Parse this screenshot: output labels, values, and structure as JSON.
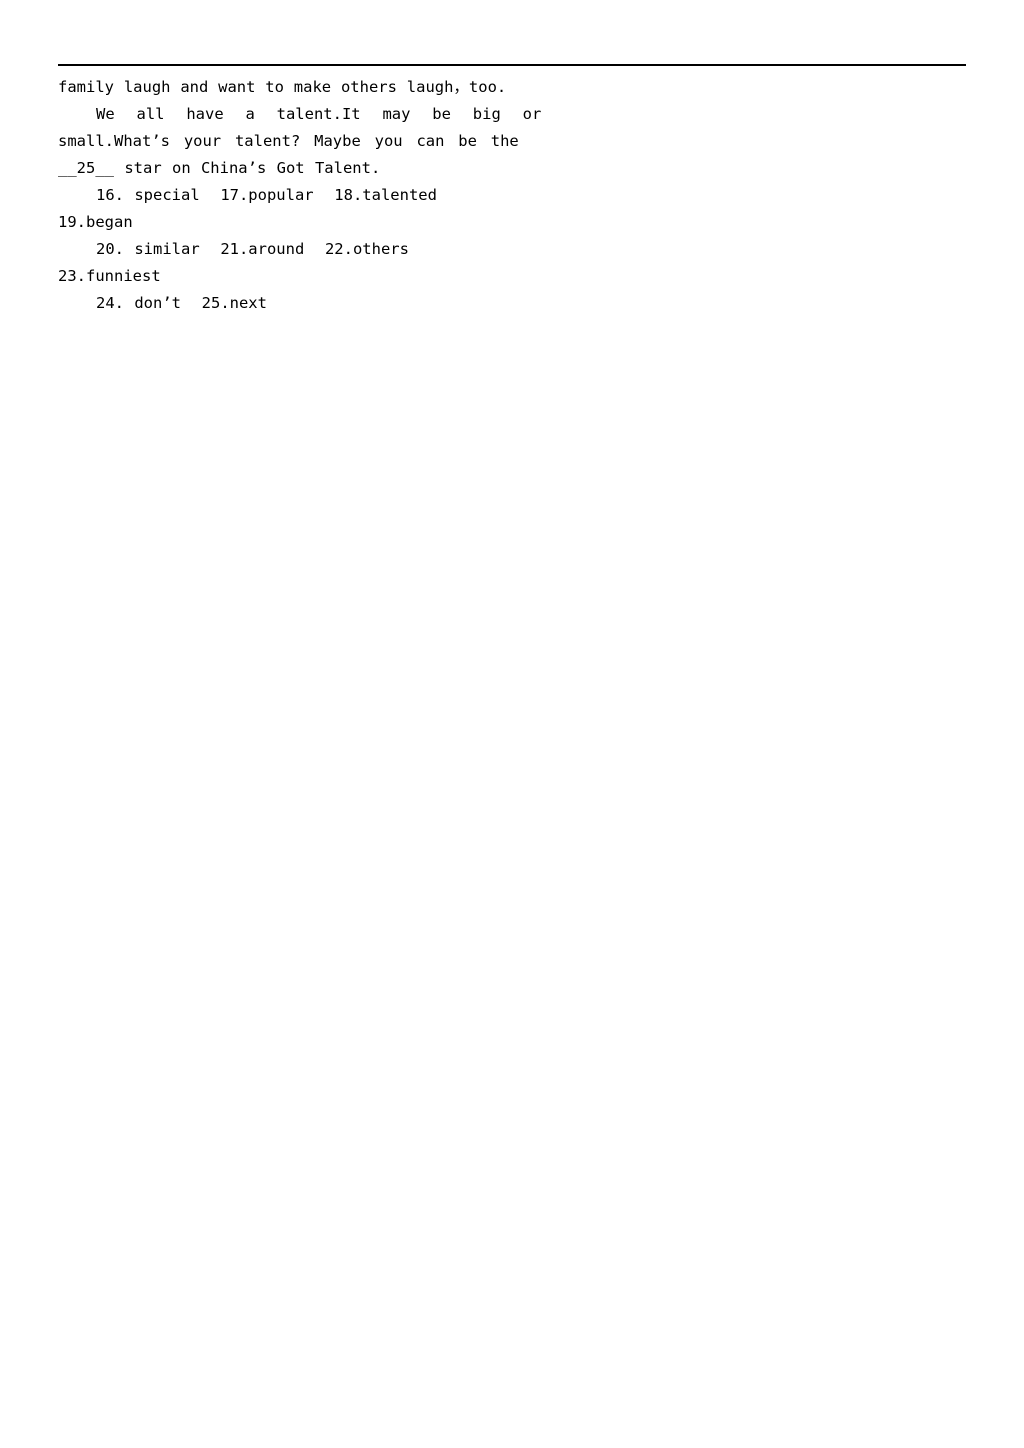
{
  "document": {
    "type": "worksheet-answer-key",
    "header_rule": true,
    "passage": {
      "lines": [
        "family laugh and want to make others laugh，too.",
        "We all have a talent.It may be big or",
        "small.What’s your talent? Maybe you can be the",
        "__25__ star on China’s Got Talent."
      ]
    },
    "answers": {
      "lines": [
        "16. special  17.popular  18.talented",
        "19.began",
        "20. similar  21.around  22.others",
        "23.funniest",
        "24. don’t  25.next"
      ],
      "items": [
        {
          "number": "16.",
          "answer": "special"
        },
        {
          "number": "17.",
          "answer": "popular"
        },
        {
          "number": "18.",
          "answer": "talented"
        },
        {
          "number": "19.",
          "answer": "began"
        },
        {
          "number": "20.",
          "answer": "similar"
        },
        {
          "number": "21.",
          "answer": "around"
        },
        {
          "number": "22.",
          "answer": "others"
        },
        {
          "number": "23.",
          "answer": "funniest"
        },
        {
          "number": "24.",
          "answer": "don’t"
        },
        {
          "number": "25.",
          "answer": "next"
        }
      ]
    },
    "colors": {
      "page_background": "#ffffff",
      "text": "#000000",
      "rule": "#000000"
    }
  }
}
